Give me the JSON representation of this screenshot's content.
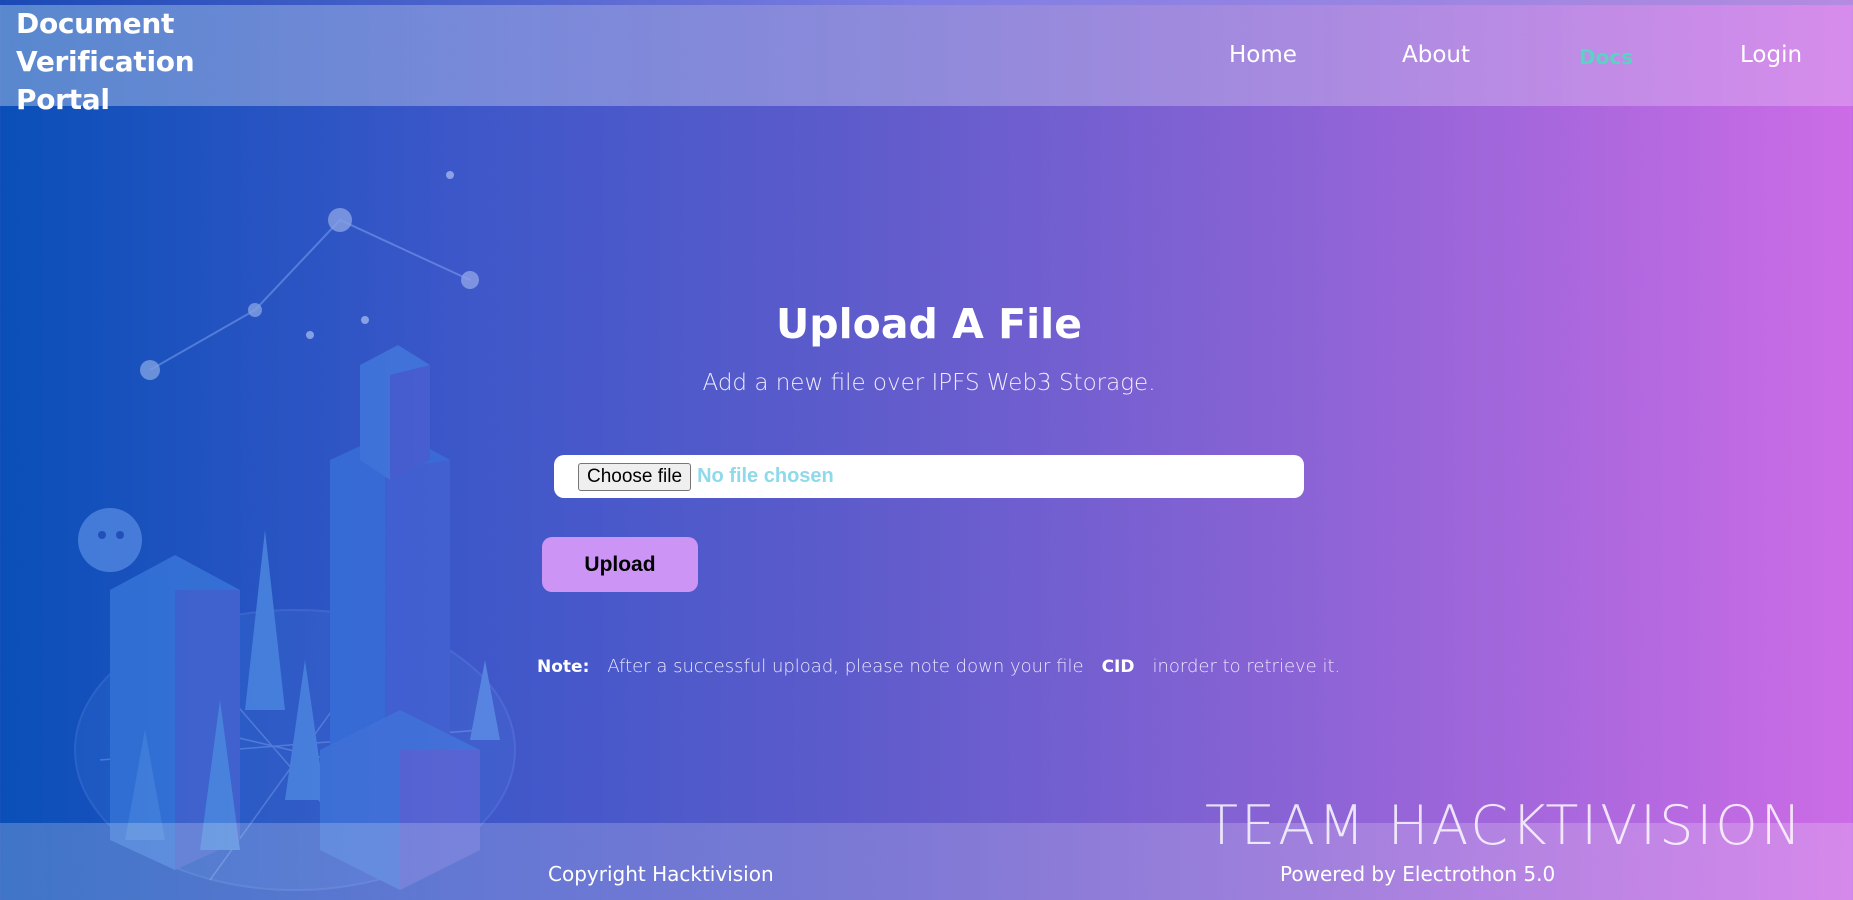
{
  "brand": {
    "title": "Document Verification Portal"
  },
  "nav": {
    "items": [
      {
        "label": "Home",
        "active": false
      },
      {
        "label": "About",
        "active": false
      },
      {
        "label": "Docs",
        "active": true
      },
      {
        "label": "Login",
        "active": false
      }
    ]
  },
  "main": {
    "title": "Upload A File",
    "subtitle": "Add a new file over IPFS Web3 Storage.",
    "file_input": {
      "button_label": "Choose file",
      "status": "No file chosen"
    },
    "upload_label": "Upload",
    "note": {
      "label": "Note:",
      "text_before": "After a successful upload, please note down your file",
      "highlight": "CID",
      "text_after": "inorder to retrieve it."
    }
  },
  "footer": {
    "copyright": "Copyright Hacktivision",
    "powered": "Powered by Electrothon 5.0",
    "team_watermark": "TEAM HACKTIVISION"
  },
  "colors": {
    "active_nav": "#5ad2c5",
    "upload_button": "#cc95f5",
    "file_status": "#8ed9ea"
  }
}
